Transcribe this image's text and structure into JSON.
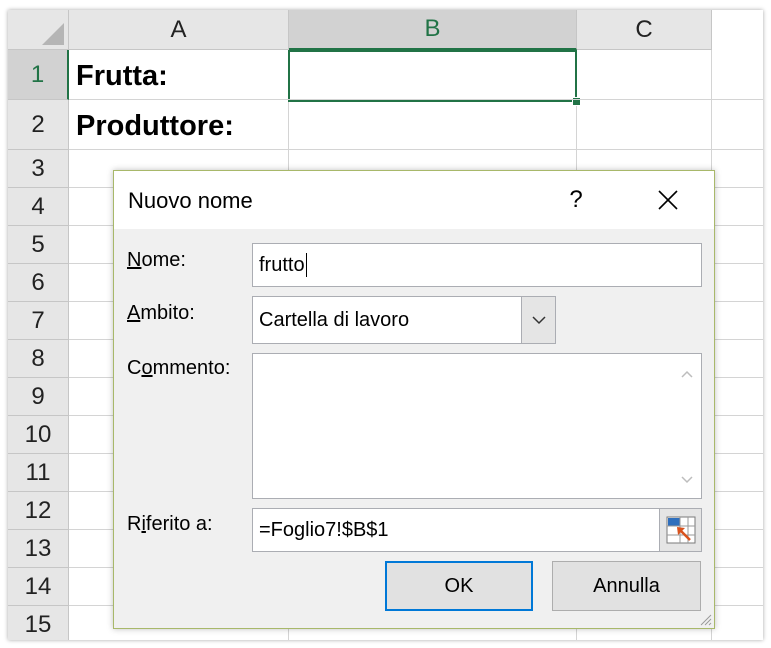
{
  "sheet": {
    "columns": [
      "A",
      "B",
      "C"
    ],
    "rows": [
      "1",
      "2",
      "3",
      "4",
      "5",
      "6",
      "7",
      "8",
      "9",
      "10",
      "11",
      "12",
      "13",
      "14",
      "15"
    ],
    "cells": {
      "A1": "Frutta:",
      "A2": "Produttore:"
    },
    "selected_cell": "B1",
    "accent_color": "#217346"
  },
  "dialog": {
    "title": "Nuovo nome",
    "help_label": "?",
    "name_label_u": "N",
    "name_label_rest": "ome:",
    "name_value": "frutto",
    "scope_label_u": "A",
    "scope_label_rest": "mbito:",
    "scope_value": "Cartella di lavoro",
    "comment_label_pre": "C",
    "comment_label_u": "o",
    "comment_label_rest": "mmento:",
    "comment_value": "",
    "ref_label_pre": "R",
    "ref_label_u": "i",
    "ref_label_rest": "ferito a:",
    "ref_value": "=Foglio7!$B$1",
    "ok_label": "OK",
    "cancel_label": "Annulla",
    "focus_color": "#0078d7"
  }
}
